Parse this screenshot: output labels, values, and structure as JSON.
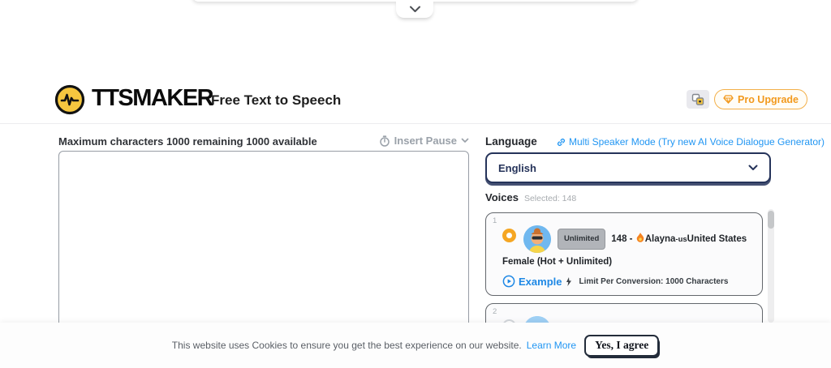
{
  "header": {
    "brand": "TTSMAKER",
    "tagline": "Free Text to Speech",
    "pro_upgrade_label": "Pro Upgrade"
  },
  "editor": {
    "char_info": "Maximum characters 1000 remaining 1000 available",
    "insert_pause_label": "Insert Pause",
    "text_value": "",
    "text_placeholder": ""
  },
  "language": {
    "label": "Language",
    "multi_speaker_link": "Multi Speaker Mode (Try new AI Voice Dialogue Generator)",
    "selected": "English"
  },
  "voices": {
    "label": "Voices",
    "selected_info": "Selected: 148",
    "cards": [
      {
        "index": "1",
        "badge": "Unlimited",
        "title_prefix": "148 -",
        "name": "Alayna",
        "locale": "-us",
        "description": "United States Female (Hot + Unlimited)",
        "example_label": "Example",
        "limit_text": "Limit Per Conversion: 1000 Characters",
        "selected": true
      },
      {
        "index": "2",
        "selected": false
      }
    ]
  },
  "cookie_banner": {
    "message": "This website uses Cookies to ensure you get the best experience on our website.",
    "learn_more_label": "Learn More",
    "agree_button_label": "Yes, I agree"
  },
  "icons": {
    "panel_toggle": "chevron-down",
    "brand_logo": "waveform-circle",
    "translate": "overlapping-squares",
    "pro_upgrade": "gem",
    "insert_pause": "timer-clock",
    "insert_pause_caret": "chevron-down",
    "multi_speaker": "link-chain",
    "language_select_caret": "chevron-down",
    "voice_radio": "radio-ring",
    "voice_avatar": "woman-sunglasses-emoji",
    "hot_flame": "flame",
    "example_play": "play-circle",
    "limit": "lightning-bolt"
  },
  "colors": {
    "accent_orange": "#F5A623",
    "brand_yellow": "#F5C63F",
    "link_blue": "#2196F3",
    "navy": "#25335A",
    "badge_gray": "#B1B4B9"
  }
}
